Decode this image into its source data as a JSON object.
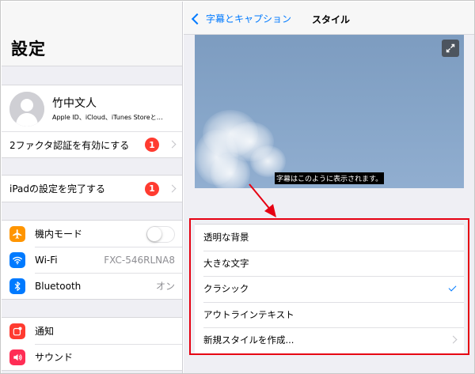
{
  "left": {
    "title": "設定",
    "profile": {
      "name": "竹中文人",
      "subtitle": "Apple ID、iCloud、iTunes Storeと…"
    },
    "two_factor": {
      "label": "2ファクタ認証を有効にする",
      "badge": "1"
    },
    "ipad_setup": {
      "label": "iPadの設定を完了する",
      "badge": "1"
    },
    "connectivity": [
      {
        "label": "機内モード",
        "icon": "airplane-icon",
        "color": "#ff9500",
        "toggle": false
      },
      {
        "label": "Wi-Fi",
        "icon": "wifi-icon",
        "color": "#007aff",
        "value": "FXC-546RLNA8"
      },
      {
        "label": "Bluetooth",
        "icon": "bluetooth-icon",
        "color": "#007aff",
        "value": "オン"
      }
    ],
    "notifications": [
      {
        "label": "通知",
        "icon": "notifications-icon",
        "color": "#ff3b30"
      },
      {
        "label": "サウンド",
        "icon": "sound-icon",
        "color": "#ff2d55"
      }
    ]
  },
  "right": {
    "back_label": "字幕とキャプション",
    "title": "スタイル",
    "caption_text": "字幕はこのように表示されます。",
    "styles": [
      {
        "label": "透明な背景",
        "selected": false
      },
      {
        "label": "大きな文字",
        "selected": false
      },
      {
        "label": "クラシック",
        "selected": true
      },
      {
        "label": "アウトラインテキスト",
        "selected": false
      },
      {
        "label": "新規スタイルを作成...",
        "disclosure": true
      }
    ]
  },
  "colors": {
    "accent": "#007aff",
    "badge": "#ff3b30",
    "annotation": "#e60012"
  }
}
